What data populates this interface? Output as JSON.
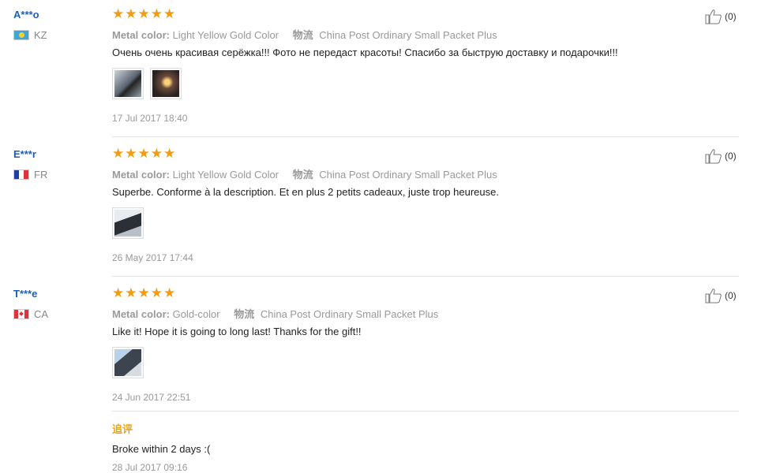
{
  "reviews": [
    {
      "user": "A***o",
      "country_code": "KZ",
      "stars": 5,
      "color_label": "Metal color:",
      "color_value": "Light Yellow Gold Color",
      "shipping_label": "物流",
      "shipping_value": "China Post Ordinary Small Packet Plus",
      "comment": "Очень очень красивая серёжка!!! Фото не передаст красоты! Спасибо за быструю доставку и подарочки!!!",
      "date": "17 Jul 2017 18:40",
      "helpful_count": "(0)"
    },
    {
      "user": "E***r",
      "country_code": "FR",
      "stars": 5,
      "color_label": "Metal color:",
      "color_value": "Light Yellow Gold Color",
      "shipping_label": "物流",
      "shipping_value": "China Post Ordinary Small Packet Plus",
      "comment": "Superbe. Conforme à la description. Et en plus 2 petits cadeaux, juste trop heureuse.",
      "date": "26 May 2017 17:44",
      "helpful_count": "(0)"
    },
    {
      "user": "T***e",
      "country_code": "CA",
      "stars": 5,
      "color_label": "Metal color:",
      "color_value": "Gold-color",
      "shipping_label": "物流",
      "shipping_value": "China Post Ordinary Small Packet Plus",
      "comment": "Like it! Hope it is going to long last! Thanks for the gift!!",
      "date": "24 Jun 2017 22:51",
      "helpful_count": "(0)",
      "followup": {
        "label": "追评",
        "comment": "Broke within 2 days :(",
        "date": "28 Jul 2017 09:16"
      }
    }
  ],
  "colors": {
    "star": "#f39c12",
    "user": "#1e5fb4",
    "followup": "#e8a317"
  }
}
